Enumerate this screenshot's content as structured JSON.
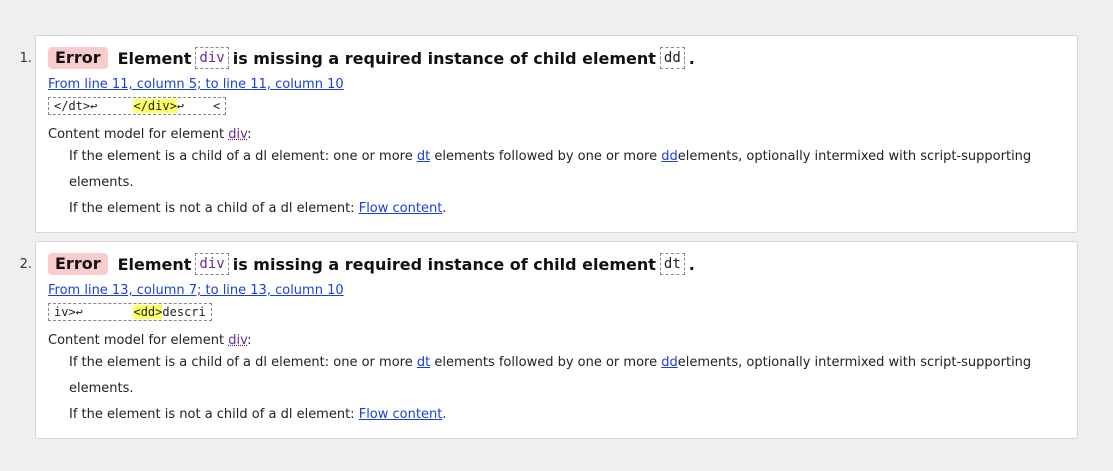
{
  "messages": [
    {
      "number": "1.",
      "badge": "Error",
      "msg_pre": "Element",
      "element": "div",
      "msg_mid": "is missing a required instance of child element",
      "child": "dd",
      "msg_end": ".",
      "location": "From line 11, column 5; to line 11, column 10",
      "extract_pre": "</dt>↩     ",
      "extract_hl": "</div>",
      "extract_post": "↩    <",
      "model_label": "Content model for element",
      "model_element": "div",
      "model_colon": ":",
      "rule1_pre": "If the element is a child of a",
      "rule1_dl": "dl",
      "rule1_mid1": "element: one or more",
      "rule1_dt": "dt",
      "rule1_mid2": "elements followed by one or more",
      "rule1_dd": "dd",
      "rule1_post": "elements, optionally intermixed with script-supporting elements.",
      "rule2_pre": "If the element is not a child of a",
      "rule2_dl": "dl",
      "rule2_mid": "element:",
      "rule2_link": "Flow content",
      "rule2_end": "."
    },
    {
      "number": "2.",
      "badge": "Error",
      "msg_pre": "Element",
      "element": "div",
      "msg_mid": "is missing a required instance of child element",
      "child": "dt",
      "msg_end": ".",
      "location": "From line 13, column 7; to line 13, column 10",
      "extract_pre": "iv>↩       ",
      "extract_hl": "<dd>",
      "extract_post": "descri",
      "model_label": "Content model for element",
      "model_element": "div",
      "model_colon": ":",
      "rule1_pre": "If the element is a child of a",
      "rule1_dl": "dl",
      "rule1_mid1": "element: one or more",
      "rule1_dt": "dt",
      "rule1_mid2": "elements followed by one or more",
      "rule1_dd": "dd",
      "rule1_post": "elements, optionally intermixed with script-supporting elements.",
      "rule2_pre": "If the element is not a child of a",
      "rule2_dl": "dl",
      "rule2_mid": "element:",
      "rule2_link": "Flow content",
      "rule2_end": "."
    }
  ],
  "colors": {
    "badge_bg": "#f8cccc",
    "link": "#1a3fd6",
    "element_ref": "#6a2c91",
    "highlight": "#ffff66"
  }
}
